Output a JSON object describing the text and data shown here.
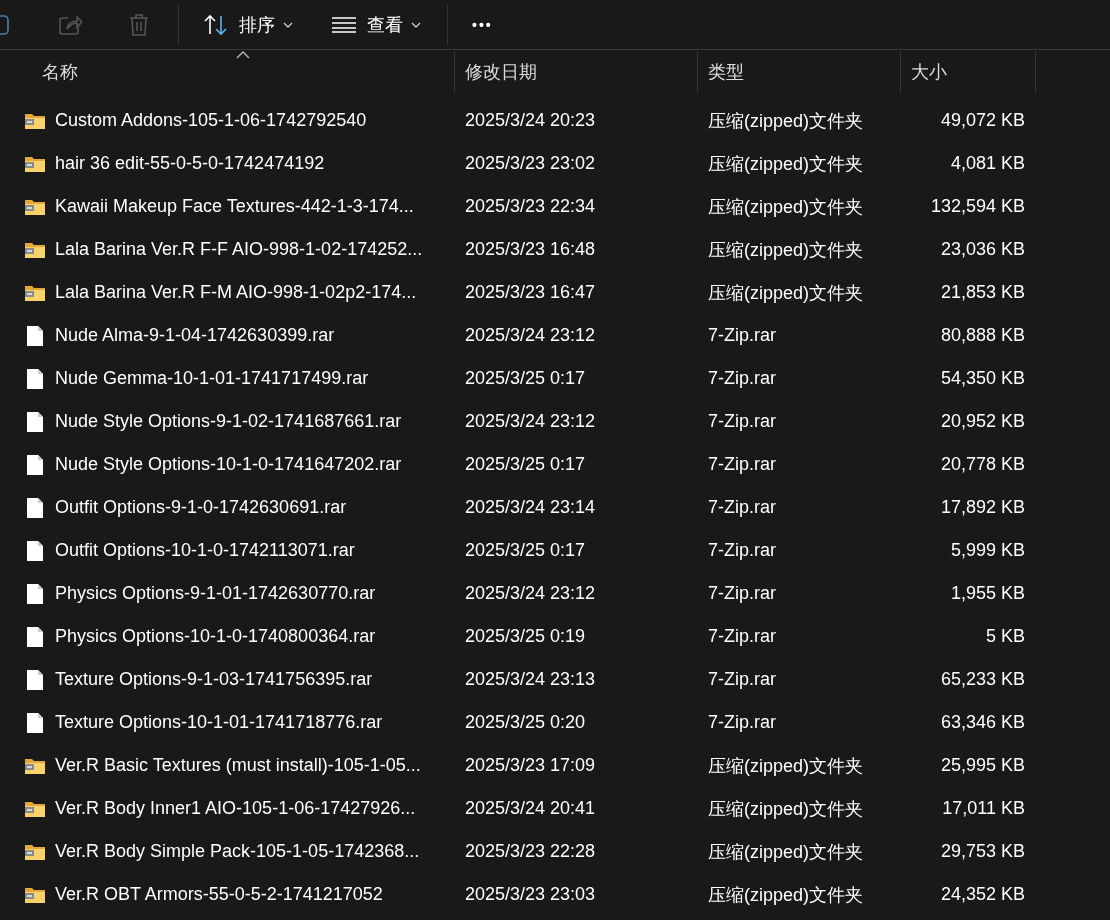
{
  "toolbar": {
    "sort_button": "排序",
    "view_button": "查看",
    "more_button": "•••"
  },
  "columns": [
    {
      "label": "名称",
      "sorted": true
    },
    {
      "label": "修改日期",
      "sorted": false
    },
    {
      "label": "类型",
      "sorted": false
    },
    {
      "label": "大小",
      "sorted": false
    }
  ],
  "files": [
    {
      "kind": "zip",
      "name": "Custom Addons-105-1-06-1742792540",
      "modified": "2025/3/24 20:23",
      "type": "压缩(zipped)文件夹",
      "size": "49,072 KB"
    },
    {
      "kind": "zip",
      "name": "hair 36 edit-55-0-5-0-1742474192",
      "modified": "2025/3/23 23:02",
      "type": "压缩(zipped)文件夹",
      "size": "4,081 KB"
    },
    {
      "kind": "zip",
      "name": "Kawaii Makeup Face Textures-442-1-3-174...",
      "modified": "2025/3/23 22:34",
      "type": "压缩(zipped)文件夹",
      "size": "132,594 KB"
    },
    {
      "kind": "zip",
      "name": "Lala Barina Ver.R F-F AIO-998-1-02-174252...",
      "modified": "2025/3/23 16:48",
      "type": "压缩(zipped)文件夹",
      "size": "23,036 KB"
    },
    {
      "kind": "zip",
      "name": "Lala Barina Ver.R F-M AIO-998-1-02p2-174...",
      "modified": "2025/3/23 16:47",
      "type": "压缩(zipped)文件夹",
      "size": "21,853 KB"
    },
    {
      "kind": "file",
      "name": "Nude Alma-9-1-04-1742630399.rar",
      "modified": "2025/3/24 23:12",
      "type": "7-Zip.rar",
      "size": "80,888 KB"
    },
    {
      "kind": "file",
      "name": "Nude Gemma-10-1-01-1741717499.rar",
      "modified": "2025/3/25 0:17",
      "type": "7-Zip.rar",
      "size": "54,350 KB"
    },
    {
      "kind": "file",
      "name": "Nude Style Options-9-1-02-1741687661.rar",
      "modified": "2025/3/24 23:12",
      "type": "7-Zip.rar",
      "size": "20,952 KB"
    },
    {
      "kind": "file",
      "name": "Nude Style Options-10-1-0-1741647202.rar",
      "modified": "2025/3/25 0:17",
      "type": "7-Zip.rar",
      "size": "20,778 KB"
    },
    {
      "kind": "file",
      "name": "Outfit Options-9-1-0-1742630691.rar",
      "modified": "2025/3/24 23:14",
      "type": "7-Zip.rar",
      "size": "17,892 KB"
    },
    {
      "kind": "file",
      "name": "Outfit Options-10-1-0-1742113071.rar",
      "modified": "2025/3/25 0:17",
      "type": "7-Zip.rar",
      "size": "5,999 KB"
    },
    {
      "kind": "file",
      "name": "Physics Options-9-1-01-1742630770.rar",
      "modified": "2025/3/24 23:12",
      "type": "7-Zip.rar",
      "size": "1,955 KB"
    },
    {
      "kind": "file",
      "name": "Physics Options-10-1-0-1740800364.rar",
      "modified": "2025/3/25 0:19",
      "type": "7-Zip.rar",
      "size": "5 KB"
    },
    {
      "kind": "file",
      "name": "Texture Options-9-1-03-1741756395.rar",
      "modified": "2025/3/24 23:13",
      "type": "7-Zip.rar",
      "size": "65,233 KB"
    },
    {
      "kind": "file",
      "name": "Texture Options-10-1-01-1741718776.rar",
      "modified": "2025/3/25 0:20",
      "type": "7-Zip.rar",
      "size": "63,346 KB"
    },
    {
      "kind": "zip",
      "name": "Ver.R Basic Textures (must install)-105-1-05...",
      "modified": "2025/3/23 17:09",
      "type": "压缩(zipped)文件夹",
      "size": "25,995 KB"
    },
    {
      "kind": "zip",
      "name": "Ver.R Body Inner1 AIO-105-1-06-17427926...",
      "modified": "2025/3/24 20:41",
      "type": "压缩(zipped)文件夹",
      "size": "17,011 KB"
    },
    {
      "kind": "zip",
      "name": "Ver.R Body Simple Pack-105-1-05-1742368...",
      "modified": "2025/3/23 22:28",
      "type": "压缩(zipped)文件夹",
      "size": "29,753 KB"
    },
    {
      "kind": "zip",
      "name": "Ver.R OBT Armors-55-0-5-2-1741217052",
      "modified": "2025/3/23 23:03",
      "type": "压缩(zipped)文件夹",
      "size": "24,352 KB"
    }
  ]
}
